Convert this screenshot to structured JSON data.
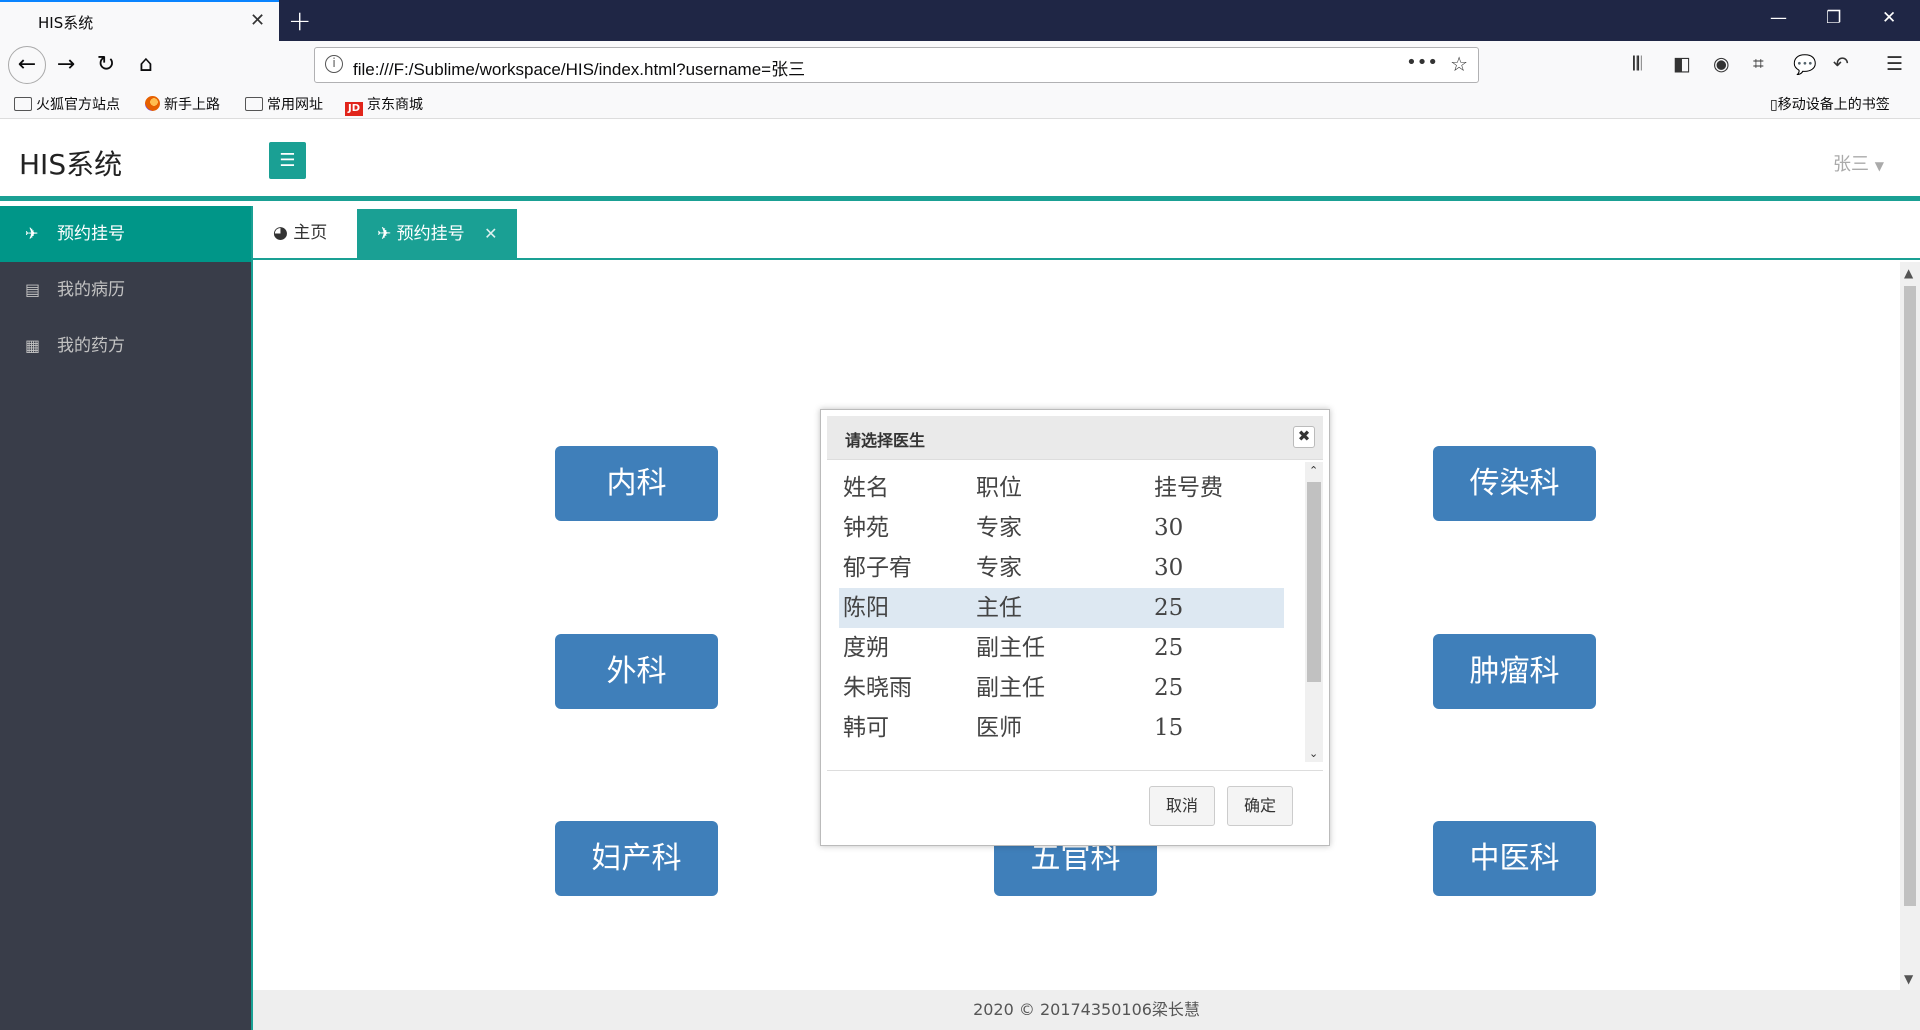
{
  "browser": {
    "tab_title": "HIS系统",
    "tab_close": "✕",
    "new_tab": "+",
    "url": "file:///F:/Sublime/workspace/HIS/index.html?username=张三",
    "url_more": "•••",
    "bookmarks": [
      {
        "label": "火狐官方站点",
        "icon": "folder-icon"
      },
      {
        "label": "新手上路",
        "icon": "firefox-icon"
      },
      {
        "label": "常用网址",
        "icon": "folder-icon"
      },
      {
        "label": "京东商城",
        "icon": "jd-icon"
      }
    ],
    "jd_badge": "JD",
    "mobile_bookmarks": "移动设备上的书签"
  },
  "app": {
    "logo": "HIS系统",
    "user": "张三",
    "sidebar": [
      {
        "label": "预约挂号",
        "icon": "paper-plane-icon",
        "active": true
      },
      {
        "label": "我的病历",
        "icon": "document-icon",
        "active": false
      },
      {
        "label": "我的药方",
        "icon": "calendar-icon",
        "active": false
      }
    ],
    "tabs": {
      "home": "主页",
      "active": "预约挂号"
    },
    "departments": [
      "内科",
      "传染科",
      "外科",
      "肿瘤科",
      "妇产科",
      "五官科",
      "中医科"
    ],
    "footer": "2020 © 20174350106梁长慧"
  },
  "modal": {
    "title": "请选择医生",
    "headers": [
      "姓名",
      "职位",
      "挂号费"
    ],
    "rows": [
      [
        "钟苑",
        "专家",
        "30"
      ],
      [
        "郁子宥",
        "专家",
        "30"
      ],
      [
        "陈阳",
        "主任",
        "25"
      ],
      [
        "度朔",
        "副主任",
        "25"
      ],
      [
        "朱晓雨",
        "副主任",
        "25"
      ],
      [
        "韩可",
        "医师",
        "15"
      ]
    ],
    "selected_row": 2,
    "cancel": "取消",
    "ok": "确定"
  },
  "colors": {
    "accent": "#1aa094",
    "sidebar_bg": "#393d49",
    "dept_btn": "#3f7fba",
    "tabstrip": "#1f2645"
  }
}
